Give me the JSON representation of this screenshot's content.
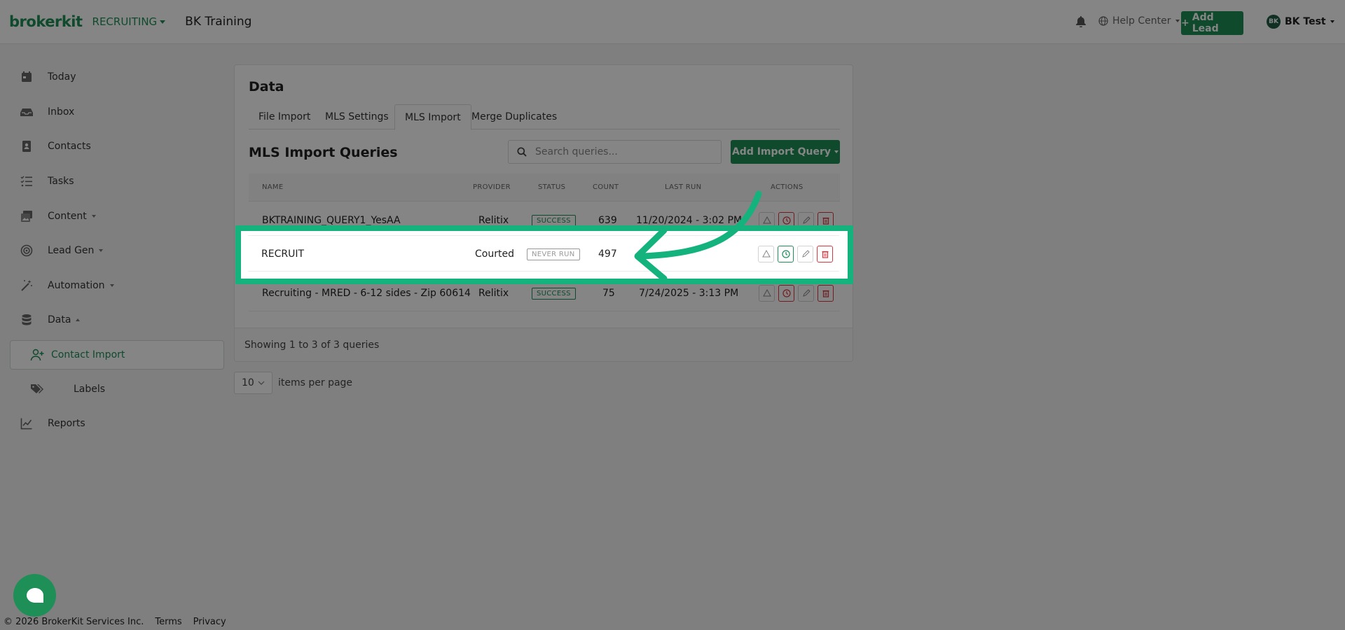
{
  "header": {
    "logo": "brokerkit",
    "product": "RECRUITING",
    "org": "BK Training",
    "help": "Help Center",
    "add_lead": "Add Lead",
    "user_initials": "BK",
    "user_name": "BK Test"
  },
  "sidebar": {
    "items": [
      {
        "label": "Today",
        "icon": "calendar-icon"
      },
      {
        "label": "Inbox",
        "icon": "inbox-icon"
      },
      {
        "label": "Contacts",
        "icon": "contact-book-icon"
      },
      {
        "label": "Tasks",
        "icon": "tasks-list-icon"
      },
      {
        "label": "Content",
        "icon": "images-icon"
      },
      {
        "label": "Lead Gen",
        "icon": "lead-gen-icon"
      },
      {
        "label": "Automation",
        "icon": "magic-wand-icon"
      },
      {
        "label": "Data",
        "icon": "database-icon"
      },
      {
        "label": "Contact Import",
        "icon": "user-plus-icon"
      },
      {
        "label": "Labels",
        "icon": "tags-icon"
      },
      {
        "label": "Reports",
        "icon": "chart-line-icon"
      }
    ]
  },
  "main": {
    "title": "Data",
    "tabs": [
      "File Import",
      "MLS Settings",
      "MLS Import",
      "Merge Duplicates"
    ],
    "active_tab": "MLS Import",
    "section_title": "MLS Import Queries",
    "search_placeholder": "Search queries...",
    "add_query": "Add Import Query",
    "columns": [
      "NAME",
      "PROVIDER",
      "STATUS",
      "COUNT",
      "LAST RUN",
      "ACTIONS"
    ],
    "rows": [
      {
        "name": "BKTRAINING_QUERY1_YesAA",
        "provider": "Relitix",
        "status": "SUCCESS",
        "count": "639",
        "last_run": "11/20/2024 - 3:02 PM"
      },
      {
        "name": "RECRUIT",
        "provider": "Courted",
        "status": "NEVER RUN",
        "count": "497",
        "last_run": ""
      },
      {
        "name": "Recruiting - MRED - 6-12 sides - Zip 60614",
        "provider": "Relitix",
        "status": "SUCCESS",
        "count": "75",
        "last_run": "7/24/2025 - 3:13 PM"
      }
    ],
    "showing": "Showing 1 to 3 of 3 queries",
    "per_page_value": "10",
    "per_page_label": "items per page"
  },
  "footer": {
    "copyright": "© 2026 BrokerKit Services Inc.",
    "terms": "Terms",
    "privacy": "Privacy"
  },
  "colors": {
    "brand": "#1d8f57",
    "highlight": "#14b37d",
    "danger": "#d9363e"
  }
}
